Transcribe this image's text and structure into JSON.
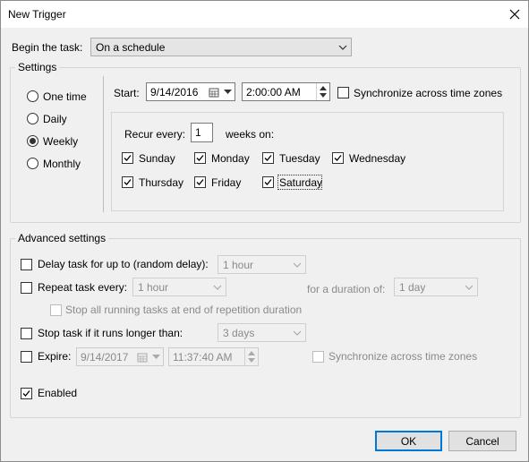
{
  "window": {
    "title": "New Trigger"
  },
  "begin": {
    "label": "Begin the task:",
    "value": "On a schedule"
  },
  "settings": {
    "title": "Settings",
    "schedule_options": [
      {
        "label": "One time",
        "selected": false
      },
      {
        "label": "Daily",
        "selected": false
      },
      {
        "label": "Weekly",
        "selected": true
      },
      {
        "label": "Monthly",
        "selected": false
      }
    ],
    "start_label": "Start:",
    "start_date": "9/14/2016",
    "start_time": "2:00:00 AM",
    "sync_label": "Synchronize across time zones",
    "sync_checked": false,
    "recur_label": "Recur every:",
    "recur_value": "1",
    "weeks_on_label": "weeks on:",
    "days": [
      {
        "label": "Sunday",
        "checked": true
      },
      {
        "label": "Monday",
        "checked": true
      },
      {
        "label": "Tuesday",
        "checked": true
      },
      {
        "label": "Wednesday",
        "checked": true
      },
      {
        "label": "Thursday",
        "checked": true
      },
      {
        "label": "Friday",
        "checked": true
      },
      {
        "label": "Saturday",
        "checked": true
      }
    ]
  },
  "advanced": {
    "title": "Advanced settings",
    "delay_label": "Delay task for up to (random delay):",
    "delay_value": "1 hour",
    "delay_checked": false,
    "repeat_label": "Repeat task every:",
    "repeat_value": "1 hour",
    "repeat_checked": false,
    "duration_label": "for a duration of:",
    "duration_value": "1 day",
    "stop_all_label": "Stop all running tasks at end of repetition duration",
    "stop_all_checked": false,
    "stop_longer_label": "Stop task if it runs longer than:",
    "stop_longer_value": "3 days",
    "stop_longer_checked": false,
    "expire_label": "Expire:",
    "expire_date": "9/14/2017",
    "expire_time": "11:37:40 AM",
    "expire_checked": false,
    "expire_sync_label": "Synchronize across time zones",
    "enabled_label": "Enabled",
    "enabled_checked": true
  },
  "buttons": {
    "ok": "OK",
    "cancel": "Cancel"
  }
}
